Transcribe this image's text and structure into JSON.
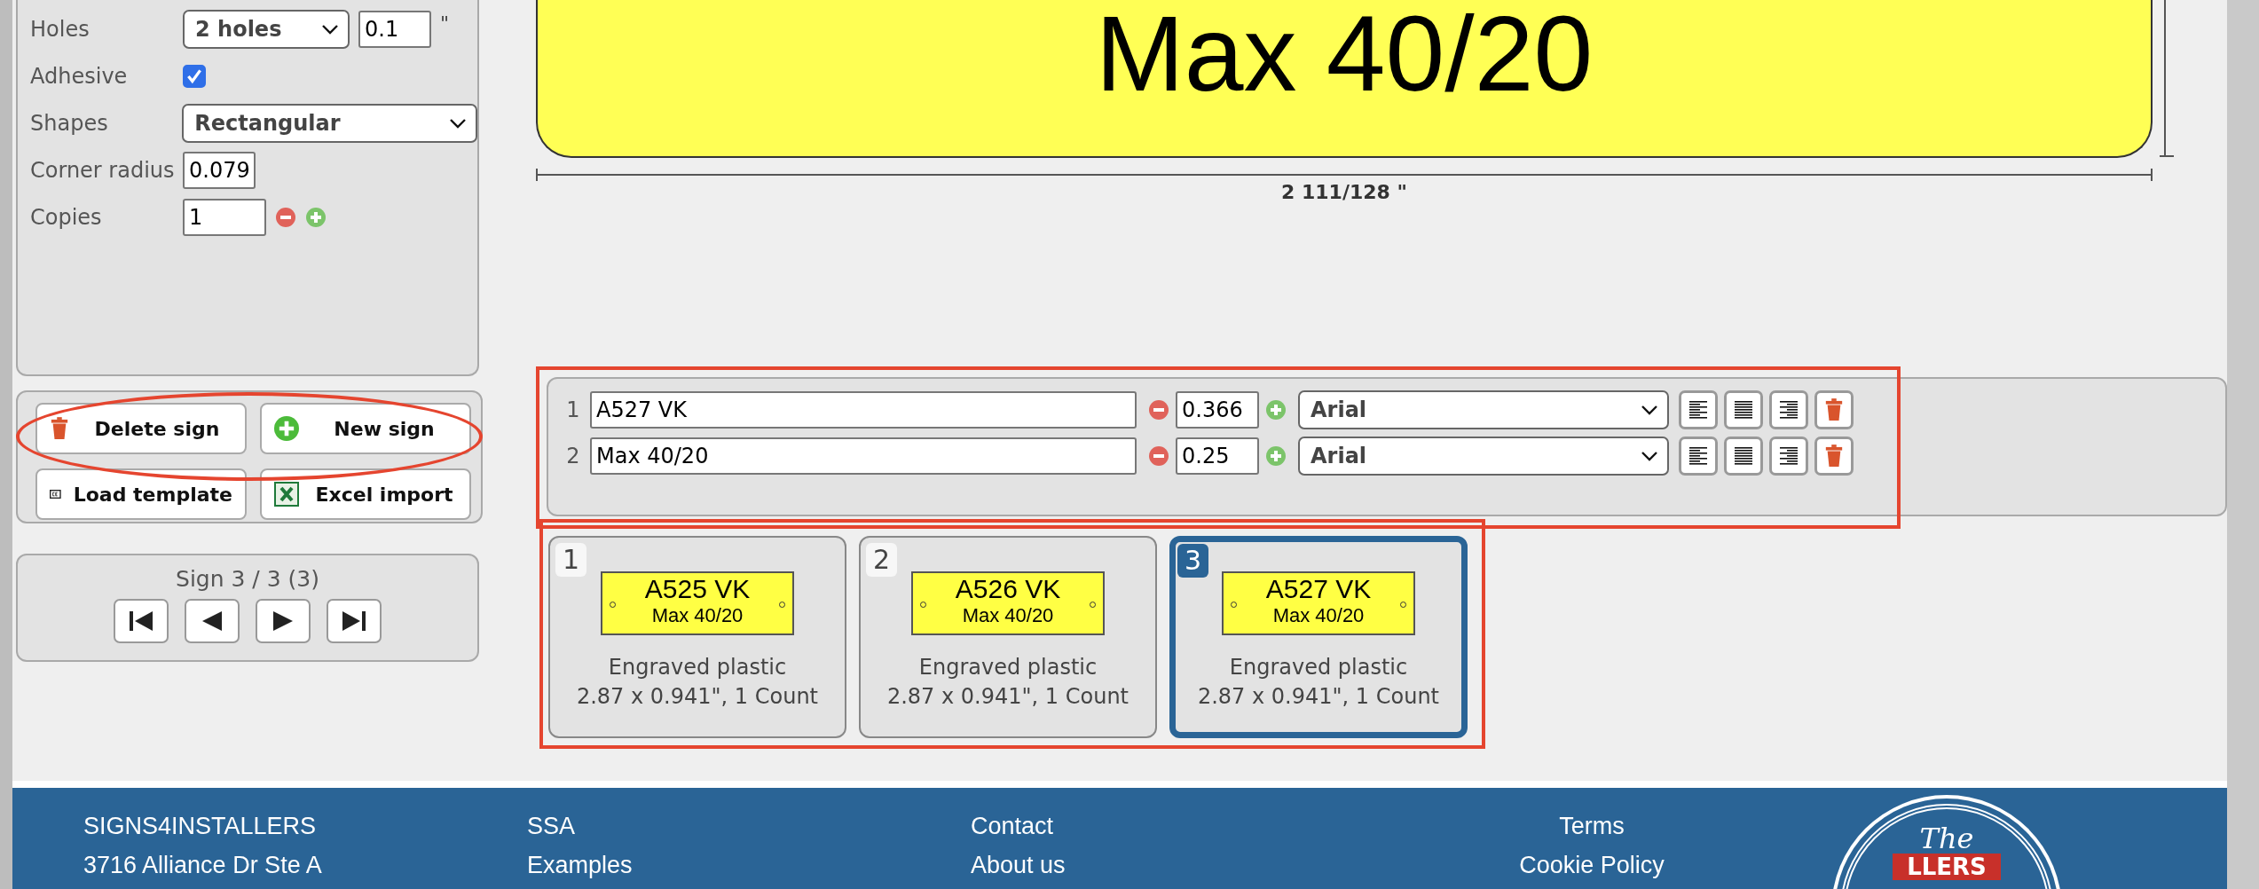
{
  "settings": {
    "fields": [
      {
        "kind": "select-with-input",
        "label": "Holes",
        "value": "2 holes",
        "input": "0.1",
        "unit": "\""
      },
      {
        "kind": "checkbox",
        "label": "Adhesive",
        "checked": true
      },
      {
        "kind": "select",
        "label": "Shapes",
        "value": "Rectangular"
      },
      {
        "kind": "input",
        "label": "Corner radius",
        "value": "0.079"
      },
      {
        "kind": "stepper",
        "label": "Copies",
        "value": "1"
      }
    ]
  },
  "actions": [
    {
      "kind": "delete",
      "label": "Delete sign"
    },
    {
      "kind": "new",
      "label": "New sign"
    },
    {
      "kind": "template",
      "label": "Load template"
    },
    {
      "kind": "excel",
      "label": "Excel import"
    }
  ],
  "navigator": {
    "label": "Sign 3 / 3 (3)"
  },
  "preview": {
    "text": "Max 40/20",
    "width_label": "2 111/128 \""
  },
  "text_lines": [
    {
      "number": "1",
      "text": "A527 VK",
      "size": "0.366",
      "font": "Arial"
    },
    {
      "number": "2",
      "text": "Max 40/20",
      "size": "0.25",
      "font": "Arial"
    }
  ],
  "thumbnails": [
    {
      "number": "1",
      "line_1": "A525 VK",
      "line_2": "Max 40/20",
      "material": "Engraved plastic",
      "details": "2.87 x 0.941\", 1 Count",
      "selected": false
    },
    {
      "number": "2",
      "line_1": "A526 VK",
      "line_2": "Max 40/20",
      "material": "Engraved plastic",
      "details": "2.87 x 0.941\", 1 Count",
      "selected": false
    },
    {
      "number": "3",
      "line_1": "A527 VK",
      "line_2": "Max 40/20",
      "material": "Engraved plastic",
      "details": "2.87 x 0.941\", 1 Count",
      "selected": true
    }
  ],
  "footer": {
    "columns": [
      {
        "items": [
          "SIGNS4INSTALLERS",
          "3716 Alliance Dr Ste A"
        ]
      },
      {
        "items": [
          "SSA",
          "Examples"
        ]
      },
      {
        "items": [
          "Contact",
          "About us"
        ]
      },
      {
        "items": [
          "Terms",
          "Cookie Policy"
        ]
      }
    ],
    "logo": {
      "top": "The",
      "band": "LLERS"
    }
  }
}
